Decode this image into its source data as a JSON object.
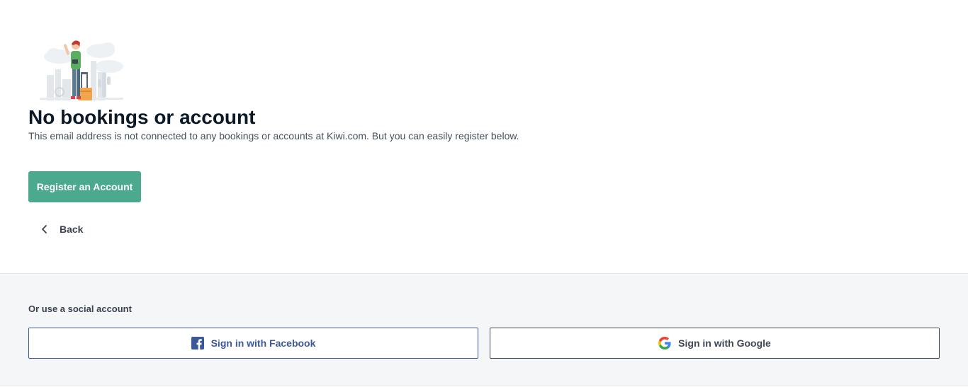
{
  "main": {
    "title": "No bookings or account",
    "subtitle": "This email address is not connected to any bookings or accounts at Kiwi.com. But you can easily register below.",
    "register_label": "Register an Account",
    "back_label": "Back"
  },
  "social": {
    "heading": "Or use a social account",
    "facebook_label": "Sign in with Facebook",
    "google_label": "Sign in with Google"
  },
  "colors": {
    "primary_green": "#4aa98f",
    "facebook_blue": "#3b5998",
    "panel_background": "#f5f6f8"
  },
  "icons": {
    "illustration": "traveler-with-suitcase-illustration",
    "back": "chevron-left-icon",
    "facebook": "facebook-icon",
    "google": "google-icon"
  }
}
